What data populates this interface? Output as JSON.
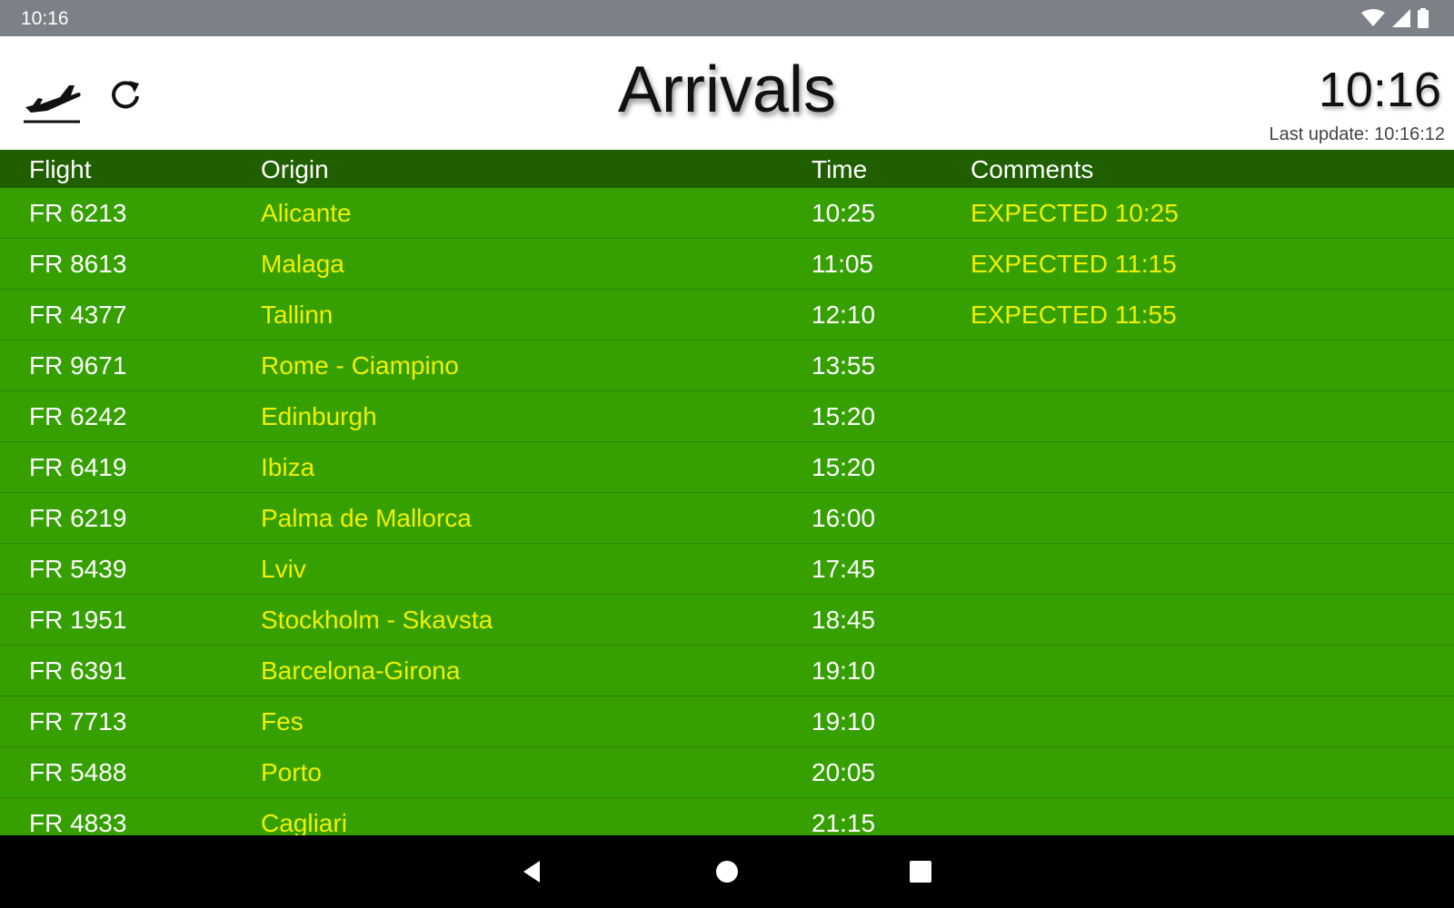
{
  "status_bar": {
    "time": "10:16"
  },
  "header": {
    "title": "Arrivals",
    "clock": "10:16",
    "last_update": "Last update: 10:16:12",
    "icons": [
      "plane-arriving-icon",
      "refresh-icon"
    ]
  },
  "table": {
    "columns": [
      "Flight",
      "Origin",
      "Time",
      "Comments"
    ],
    "rows": [
      {
        "flight": "FR 6213",
        "origin": "Alicante",
        "time": "10:25",
        "comments": "EXPECTED 10:25"
      },
      {
        "flight": "FR 8613",
        "origin": "Malaga",
        "time": "11:05",
        "comments": "EXPECTED 11:15"
      },
      {
        "flight": "FR 4377",
        "origin": "Tallinn",
        "time": "12:10",
        "comments": "EXPECTED 11:55"
      },
      {
        "flight": "FR 9671",
        "origin": "Rome - Ciampino",
        "time": "13:55",
        "comments": ""
      },
      {
        "flight": "FR 6242",
        "origin": "Edinburgh",
        "time": "15:20",
        "comments": ""
      },
      {
        "flight": "FR 6419",
        "origin": "Ibiza",
        "time": "15:20",
        "comments": ""
      },
      {
        "flight": "FR 6219",
        "origin": "Palma de Mallorca",
        "time": "16:00",
        "comments": ""
      },
      {
        "flight": "FR 5439",
        "origin": "Lviv",
        "time": "17:45",
        "comments": ""
      },
      {
        "flight": "FR 1951",
        "origin": "Stockholm - Skavsta",
        "time": "18:45",
        "comments": ""
      },
      {
        "flight": "FR 6391",
        "origin": "Barcelona-Girona",
        "time": "19:10",
        "comments": ""
      },
      {
        "flight": "FR 7713",
        "origin": "Fes",
        "time": "19:10",
        "comments": ""
      },
      {
        "flight": "FR 5488",
        "origin": "Porto",
        "time": "20:05",
        "comments": ""
      },
      {
        "flight": "FR 4833",
        "origin": "Cagliari",
        "time": "21:15",
        "comments": ""
      }
    ]
  },
  "colors": {
    "row_background": "#35a000",
    "header_background": "#1f5f00",
    "origin_text": "#f0f000",
    "status_bar": "#7b8186"
  },
  "nav_bar": {
    "icons": [
      "back-icon",
      "home-icon",
      "recents-icon"
    ]
  }
}
